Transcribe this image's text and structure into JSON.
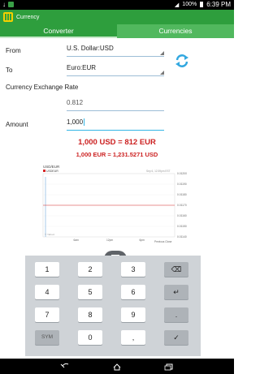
{
  "status": {
    "battery": "100%",
    "time": "6:39 PM"
  },
  "header": {
    "title": "Currency"
  },
  "tabs": [
    {
      "label": "Converter"
    },
    {
      "label": "Currencies"
    }
  ],
  "form": {
    "from_label": "From",
    "from_value": "U.S. Dollar:USD",
    "to_label": "To",
    "to_value": "Euro:EUR",
    "rate_label": "Currency Exchange Rate",
    "rate_value": "0.812",
    "amount_label": "Amount",
    "amount_value": "1,000"
  },
  "results": {
    "main": "1,000 USD = 812 EUR",
    "inverse": "1,000 EUR = 1,231.5271 USD"
  },
  "chart_data": {
    "type": "line",
    "title": "USD/EUR",
    "series": [
      {
        "name": "USDEUR",
        "color": "#d62728",
        "values": [
          0.0117,
          0.0117,
          0.0117,
          0.0117,
          0.0117
        ]
      }
    ],
    "x": [
      "",
      "6am",
      "12pm",
      "6pm",
      ""
    ],
    "yticks": [
      "0.01200",
      "0.01190",
      "0.01180",
      "0.01170",
      "0.01160",
      "0.01150",
      "0.01140"
    ],
    "ylim": [
      0.0114,
      0.012
    ],
    "header_right": "Sep 6, 12:39pm EST",
    "legend_bottom": "Previous Close",
    "source": "© Yahoo!"
  },
  "keyboard": {
    "rows": [
      [
        "1",
        "2",
        "3",
        "⌫"
      ],
      [
        "4",
        "5",
        "6",
        "↵"
      ],
      [
        "7",
        "8",
        "9",
        "."
      ],
      [
        "SYM",
        "0",
        ",",
        "✓"
      ]
    ]
  }
}
